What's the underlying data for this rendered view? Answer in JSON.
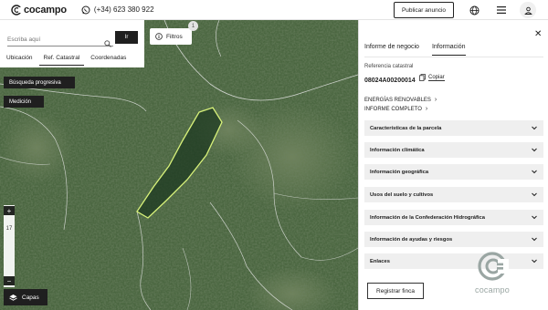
{
  "header": {
    "brand": "cocampo",
    "phone": "(+34) 623 380 922",
    "publish_label": "Publicar anuncio",
    "icons": [
      "whatsapp-icon",
      "globe-icon",
      "menu-icon",
      "user-icon"
    ]
  },
  "search": {
    "placeholder": "Escriba aquí",
    "go_label": "Ir",
    "tabs": [
      "Ubicación",
      "Ref. Catastral",
      "Coordenadas"
    ],
    "active_tab": "Ref. Catastral"
  },
  "filters": {
    "label": "Filtros",
    "count": "1"
  },
  "map_controls": {
    "progressive_search_label": "Búsqueda progresiva",
    "measure_label": "Medición",
    "zoom_in": "+",
    "zoom_out": "−",
    "zoom_level": "17",
    "layers_label": "Capas"
  },
  "panel": {
    "tabs": [
      "Informe de negocio",
      "Información"
    ],
    "active_tab": "Información",
    "ref_label": "Referencia catastral",
    "ref_value": "08024A00200014",
    "copy_label": "Copiar",
    "links": [
      "ENERGÍAS RENOVABLES",
      "INFORME COMPLETO"
    ],
    "sections": [
      "Características de la parcela",
      "Información climática",
      "Información geográfica",
      "Usos del suelo y cultivos",
      "Información de la Confederación Hidrográfica",
      "Información de ayudas y riesgos",
      "Enlaces"
    ],
    "register_label": "Registrar finca",
    "watermark": "cocampo"
  },
  "colors": {
    "accent_dark": "#1f1f1f",
    "parcel_outline": "#d8f27a",
    "accordion_bg": "#efefef",
    "watermark": "#9aa6a3"
  }
}
